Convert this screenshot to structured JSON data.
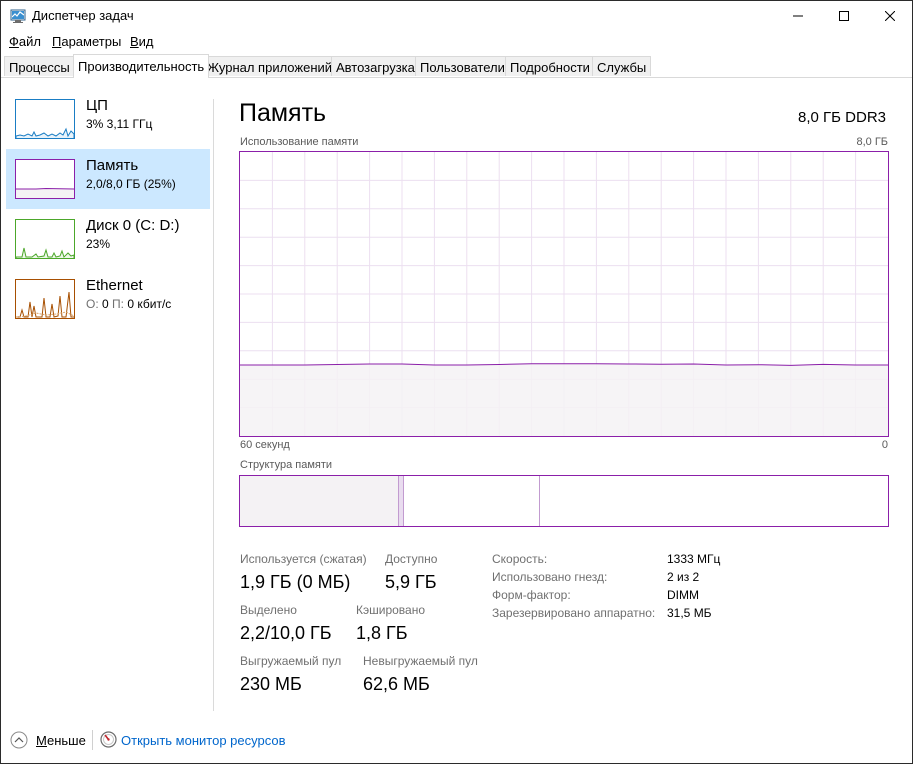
{
  "window": {
    "title": "Диспетчер задач",
    "icon": "task-manager-icon"
  },
  "menu": {
    "file": "Файл",
    "options": "Параметры",
    "view": "Вид"
  },
  "tabs": [
    {
      "label": "Процессы"
    },
    {
      "label": "Производительность",
      "active": true
    },
    {
      "label": "Журнал приложений"
    },
    {
      "label": "Автозагрузка"
    },
    {
      "label": "Пользователи"
    },
    {
      "label": "Подробности"
    },
    {
      "label": "Службы"
    }
  ],
  "sidebar": {
    "items": [
      {
        "title": "ЦП",
        "sub": "3% 3,11 ГГц",
        "color": "#1a7dc4"
      },
      {
        "title": "Память",
        "sub": "2,0/8,0 ГБ (25%)",
        "color": "#8b1fa9",
        "selected": true
      },
      {
        "title": "Диск 0 (C: D:)",
        "sub": "23%",
        "color": "#4ca72a"
      },
      {
        "title": "Ethernet",
        "sub_prefix_send": "О:",
        "sub_send": "0",
        "sub_prefix_recv": "П:",
        "sub_recv": "0 кбит/с",
        "color": "#a74f01"
      }
    ]
  },
  "memory": {
    "title": "Память",
    "total_label": "8,0 ГБ DDR3",
    "usage_chart": {
      "label": "Использование памяти",
      "max_label": "8,0 ГБ",
      "time_left": "60 секунд",
      "time_right": "0",
      "fraction": 0.25,
      "accent": "#8b1fa9",
      "fill": "#f4f2f4"
    },
    "composition": {
      "label": "Структура памяти"
    },
    "stats": {
      "in_use_label": "Используется (сжатая)",
      "in_use_value": "1,9 ГБ (0 МБ)",
      "available_label": "Доступно",
      "available_value": "5,9 ГБ",
      "committed_label": "Выделено",
      "committed_value": "2,2/10,0 ГБ",
      "cached_label": "Кэшировано",
      "cached_value": "1,8 ГБ",
      "paged_label": "Выгружаемый пул",
      "paged_value": "230 МБ",
      "nonpaged_label": "Невыгружаемый пул",
      "nonpaged_value": "62,6 МБ"
    },
    "info": [
      {
        "label": "Скорость:",
        "value": "1333 МГц"
      },
      {
        "label": "Использовано гнезд:",
        "value": "2 из 2"
      },
      {
        "label": "Форм-фактор:",
        "value": "DIMM"
      },
      {
        "label": "Зарезервировано аппаратно:",
        "value": "31,5 МБ"
      }
    ]
  },
  "footer": {
    "less_label": "Меньше",
    "monitor_link": "Открыть монитор ресурсов"
  }
}
